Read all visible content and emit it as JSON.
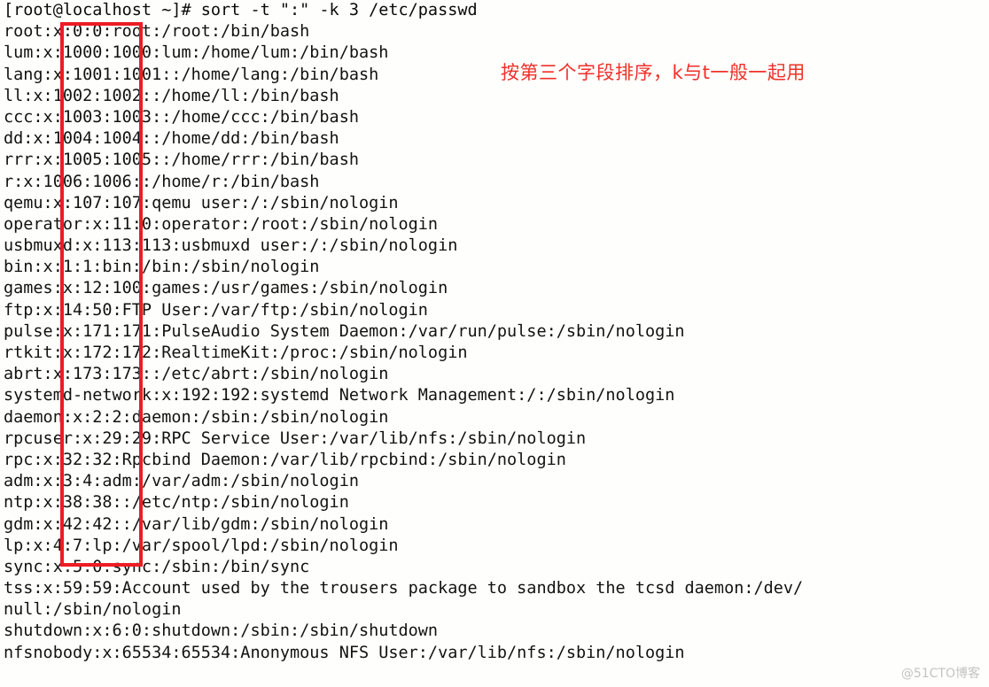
{
  "terminal": {
    "prompt": "[root@localhost ~]# ",
    "command": "sort -t \":\" -k 3 /etc/passwd",
    "prompt_line": "[root@localhost ~]# sort -t \":\" -k 3 /etc/passwd",
    "lines": [
      "[root@localhost ~]# sort -t \":\" -k 3 /etc/passwd",
      "root:x:0:0:root:/root:/bin/bash",
      "lum:x:1000:1000:lum:/home/lum:/bin/bash",
      "lang:x:1001:1001::/home/lang:/bin/bash",
      "ll:x:1002:1002::/home/ll:/bin/bash",
      "ccc:x:1003:1003::/home/ccc:/bin/bash",
      "dd:x:1004:1004::/home/dd:/bin/bash",
      "rrr:x:1005:1005::/home/rrr:/bin/bash",
      "r:x:1006:1006::/home/r:/bin/bash",
      "qemu:x:107:107:qemu user:/:/sbin/nologin",
      "operator:x:11:0:operator:/root:/sbin/nologin",
      "usbmuxd:x:113:113:usbmuxd user:/:/sbin/nologin",
      "bin:x:1:1:bin:/bin:/sbin/nologin",
      "games:x:12:100:games:/usr/games:/sbin/nologin",
      "ftp:x:14:50:FTP User:/var/ftp:/sbin/nologin",
      "pulse:x:171:171:PulseAudio System Daemon:/var/run/pulse:/sbin/nologin",
      "rtkit:x:172:172:RealtimeKit:/proc:/sbin/nologin",
      "abrt:x:173:173::/etc/abrt:/sbin/nologin",
      "systemd-network:x:192:192:systemd Network Management:/:/sbin/nologin",
      "daemon:x:2:2:daemon:/sbin:/sbin/nologin",
      "rpcuser:x:29:29:RPC Service User:/var/lib/nfs:/sbin/nologin",
      "rpc:x:32:32:Rpcbind Daemon:/var/lib/rpcbind:/sbin/nologin",
      "adm:x:3:4:adm:/var/adm:/sbin/nologin",
      "ntp:x:38:38::/etc/ntp:/sbin/nologin",
      "gdm:x:42:42::/var/lib/gdm:/sbin/nologin",
      "lp:x:4:7:lp:/var/spool/lpd:/sbin/nologin",
      "sync:x:5:0:sync:/sbin:/bin/sync",
      "tss:x:59:59:Account used by the trousers package to sandbox the tcsd daemon:/dev/",
      "null:/sbin/nologin",
      "shutdown:x:6:0:shutdown:/sbin:/sbin/shutdown",
      "nfsnobody:x:65534:65534:Anonymous NFS User:/var/lib/nfs:/sbin/nologin"
    ]
  },
  "annotation": {
    "text": "按第三个字段排序，k与t一般一起用",
    "color": "#f0302a"
  },
  "highlight": {
    "color": "#ed1c24",
    "description": "third-field-column"
  },
  "watermark": {
    "text": "@51CTO博客"
  },
  "colors": {
    "background": "#fefefc",
    "text": "#121212",
    "accent_red": "#ed1c24",
    "watermark": "#b9b9b9"
  }
}
